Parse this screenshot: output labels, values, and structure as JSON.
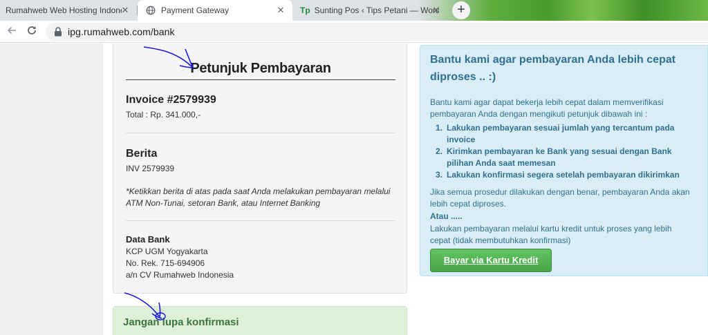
{
  "browser": {
    "tabs": [
      {
        "title": "Rumahweb Web Hosting Indonesia",
        "active": false
      },
      {
        "title": "Payment Gateway",
        "active": true
      },
      {
        "title": "Sunting Pos ‹ Tips Petani — WordPress",
        "active": false
      }
    ],
    "tab3_favicon": "Tp",
    "close_glyph": "✕",
    "new_tab_glyph": "+",
    "url": "ipg.rumahweb.com/bank"
  },
  "instructions": {
    "title": "Petunjuk Pembayaran",
    "invoice_heading": "Invoice #2579939",
    "total": "Total : Rp. 341.000,-",
    "berita_heading": "Berita",
    "berita_value": "INV 2579939",
    "note": "*Ketikkan berita di atas pada saat Anda melakukan pembayaran melalui ATM Non-Tunai, setoran Bank, atau Internet Banking",
    "bank_heading": "Data Bank",
    "bank_lines": [
      "KCP UGM Yogyakarta",
      "No. Rek. 715-694906",
      "a/n CV Rumahweb Indonesia"
    ]
  },
  "confirmation": {
    "title": "Jangan lupa konfirmasi"
  },
  "info": {
    "title": "Bantu kami agar pembayaran Anda lebih cepat diproses .. :)",
    "intro": "Bantu kami agar dapat bekerja lebih cepat dalam memverifikasi pembayaran Anda dengan mengikuti petunjuk dibawah ini :",
    "steps": [
      {
        "num": "1.",
        "text": "Lakukan pembayaran sesuai jumlah yang tercantum pada invoice"
      },
      {
        "num": "2.",
        "text": "Kirimkan pembayaran ke Bank yang sesuai dengan Bank pilihan Anda saat memesan"
      },
      {
        "num": "3.",
        "text": "Lakukan konfirmasi segera setelah pembayaran dikirimkan"
      }
    ],
    "summary": "Jika semua prosedur dilakukan dengan benar, pembayaran Anda akan lebih cepat diproses.",
    "atau": "Atau .....",
    "alternative": "Lakukan pembayaran melalui kartu kredit untuk proses yang lebih cepat (tidak membutuhkan konfirmasi)",
    "cc_button": "Bayar via Kartu Kredit"
  },
  "colors": {
    "info_text": "#31708f",
    "info_bg": "#d9edf7",
    "success_bg": "#dff0d8",
    "success_text": "#3c763d",
    "button_green": "#48a648",
    "annotation": "#1a1adb"
  }
}
